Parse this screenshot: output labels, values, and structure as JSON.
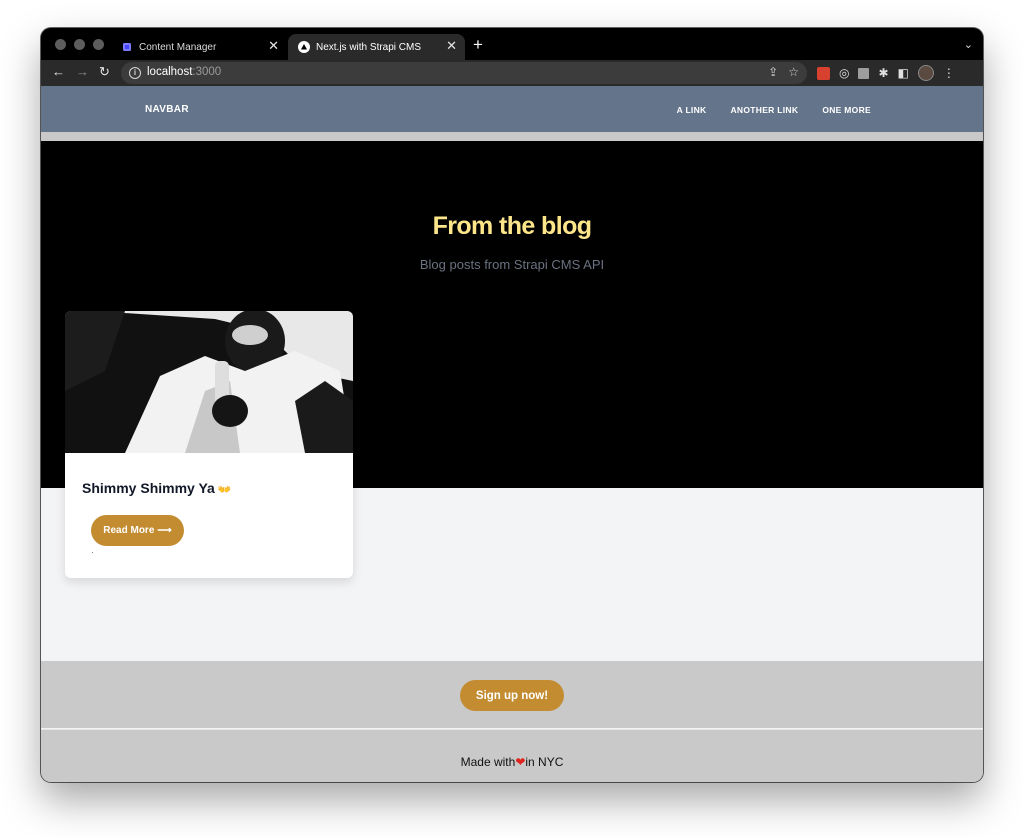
{
  "browser": {
    "tabs": [
      {
        "label": "Content Manager",
        "active": false,
        "icon": "strapi-icon"
      },
      {
        "label": "Next.js with Strapi CMS",
        "active": true,
        "icon": "nextjs-icon"
      }
    ],
    "close_glyph": "✕",
    "new_tab_glyph": "+",
    "tab_menu_glyph": "⌄",
    "url_host": "localhost",
    "url_port": ":3000"
  },
  "navbar": {
    "brand": "NAVBAR",
    "links": [
      "A LINK",
      "ANOTHER LINK",
      "ONE MORE"
    ]
  },
  "hero": {
    "title": "From the blog",
    "subtitle": "Blog posts from Strapi CMS API"
  },
  "posts": [
    {
      "title": "Shimmy Shimmy Ya",
      "title_emoji": "👐",
      "button_label": "Read More",
      "button_arrow": "⟶"
    }
  ],
  "signup": {
    "label": "Sign up now!"
  },
  "footer": {
    "prefix": "Made with",
    "heart": "❤",
    "suffix": "in NYC"
  },
  "colors": {
    "navbar_bg": "#64748b",
    "hero_bg": "#000000",
    "title_yellow": "#fde68a",
    "button_gold": "#c38c31",
    "page_bg": "#f3f4f6",
    "band_grey": "#c9c9c9"
  }
}
